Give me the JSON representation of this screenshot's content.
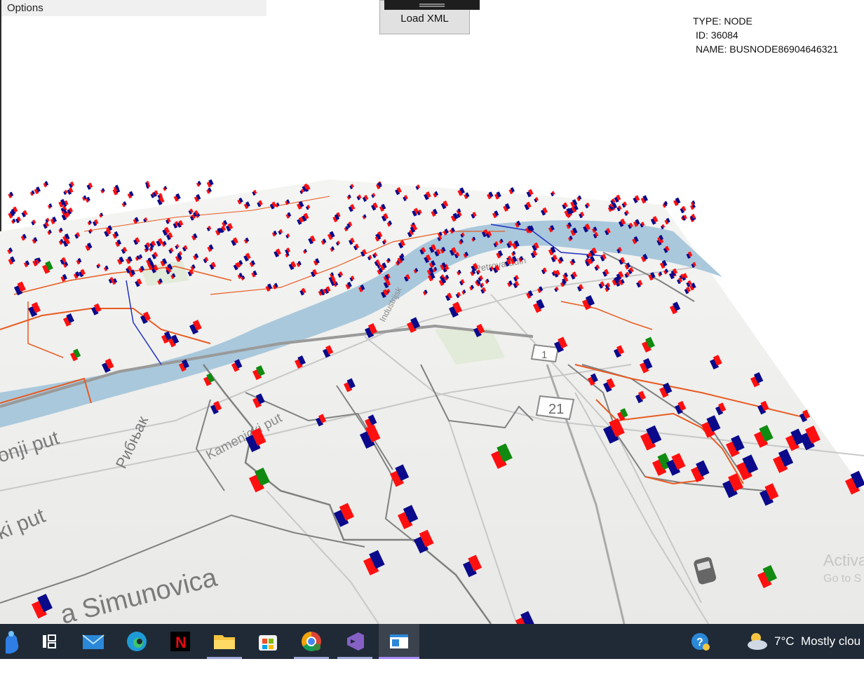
{
  "window": {
    "options_label": "Options",
    "load_button_label": "Load XML"
  },
  "info": {
    "type_line": "TYPE: NODE",
    "id_line": "ID: 36084",
    "name_line": "NAME: BUSNODE86904646321"
  },
  "map_labels": {
    "petrovaradin": "Petrovaradin",
    "road_21": "21",
    "road_1": "1",
    "kamenicki_put": "Kamenicki put",
    "simunovica": "a Simunovica",
    "put_left": "onji put",
    "put_left2": "ki put",
    "ribnjak": "Рибњак",
    "industrijska": "Industrijsk"
  },
  "watermark": {
    "line1": "Activa",
    "line2": "Go to S"
  },
  "taskbar": {
    "items": [
      {
        "name": "copilot-icon"
      },
      {
        "name": "task-view-icon"
      },
      {
        "name": "mail-icon"
      },
      {
        "name": "edge-icon"
      },
      {
        "name": "netflix-icon"
      },
      {
        "name": "file-explorer-icon"
      },
      {
        "name": "store-icon"
      },
      {
        "name": "chrome-icon"
      },
      {
        "name": "visual-studio-icon"
      },
      {
        "name": "app-window-icon"
      }
    ],
    "weather_temp": "7°C",
    "weather_text": "Mostly clou"
  },
  "colors": {
    "node_red": "#ff1010",
    "node_blue": "#0a0a8a",
    "node_green": "#108a10",
    "line_gray": "#808080",
    "line_orange": "#e85a20",
    "river": "#a9c8dc",
    "taskbar": "#1f2a36"
  }
}
